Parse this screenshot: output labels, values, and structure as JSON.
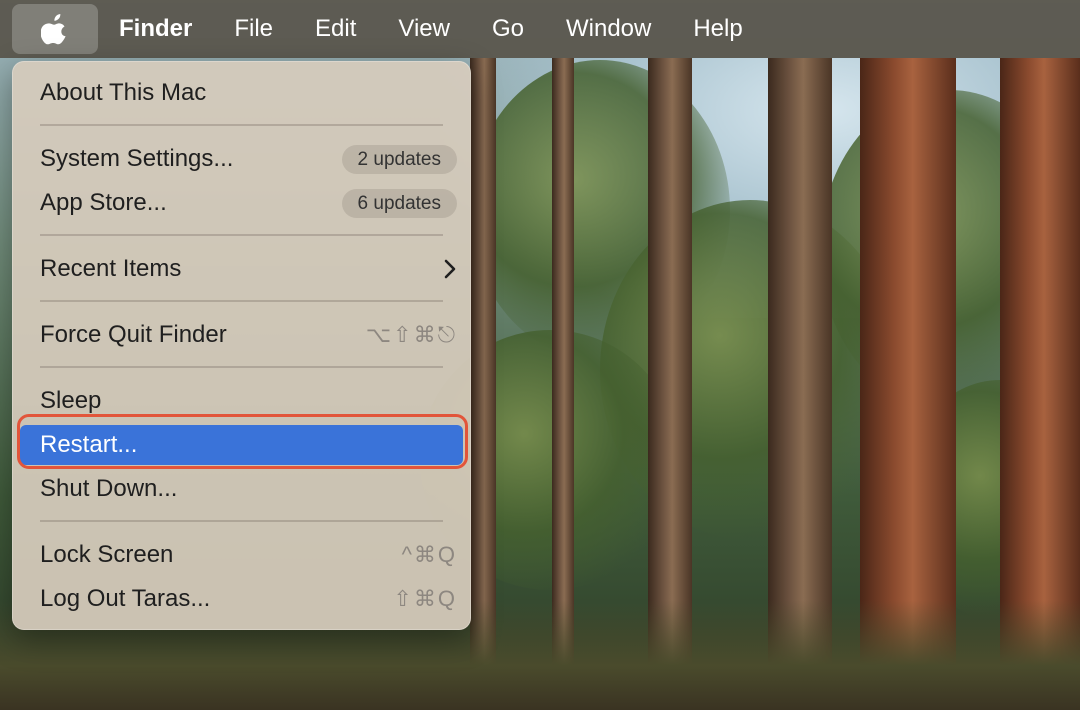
{
  "menubar": {
    "apple_icon": "apple-logo-icon",
    "items": [
      {
        "label": "Finder"
      },
      {
        "label": "File"
      },
      {
        "label": "Edit"
      },
      {
        "label": "View"
      },
      {
        "label": "Go"
      },
      {
        "label": "Window"
      },
      {
        "label": "Help"
      }
    ]
  },
  "menu": {
    "about": {
      "label": "About This Mac"
    },
    "system_settings": {
      "label": "System Settings...",
      "badge": "2 updates"
    },
    "app_store": {
      "label": "App Store...",
      "badge": "6 updates"
    },
    "recent_items": {
      "label": "Recent Items",
      "icon": "chevron-right-icon"
    },
    "force_quit": {
      "label": "Force Quit Finder",
      "shortcut": "⌥⇧⌘⎋"
    },
    "sleep": {
      "label": "Sleep"
    },
    "restart": {
      "label": "Restart...",
      "selected": true
    },
    "shut_down": {
      "label": "Shut Down..."
    },
    "lock_screen": {
      "label": "Lock Screen",
      "shortcut": "^⌘Q"
    },
    "log_out": {
      "label": "Log Out Taras...",
      "shortcut": "⇧⌘Q"
    }
  },
  "colors": {
    "selection": "#3a73d9",
    "highlight_ring": "#e2553a",
    "menubar": "#58544a"
  }
}
